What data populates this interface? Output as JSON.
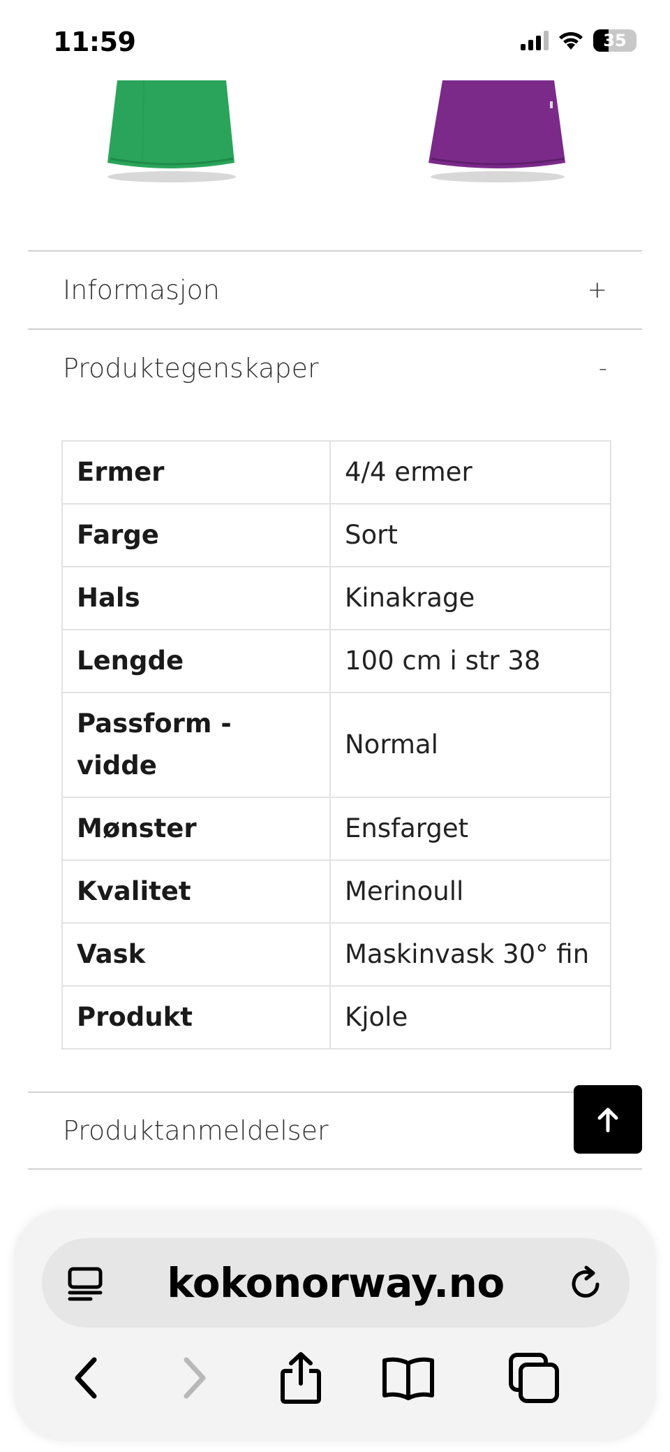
{
  "status": {
    "time": "11:59",
    "battery": "35"
  },
  "accordion": {
    "info": {
      "label": "Informasjon",
      "sign": "+"
    },
    "properties": {
      "label": "Produktegenskaper",
      "sign": "-"
    },
    "reviews": {
      "label": "Produktanmeldelser"
    }
  },
  "specs": [
    {
      "key": "Ermer",
      "value": "4/4 ermer"
    },
    {
      "key": "Farge",
      "value": "Sort"
    },
    {
      "key": "Hals",
      "value": "Kinakrage"
    },
    {
      "key": "Lengde",
      "value": "100 cm i str 38"
    },
    {
      "key": "Passform - vidde",
      "value": "Normal"
    },
    {
      "key": "Mønster",
      "value": "Ensfarget"
    },
    {
      "key": "Kvalitet",
      "value": "Merinoull"
    },
    {
      "key": "Vask",
      "value": "Maskinvask 30° fin"
    },
    {
      "key": "Produkt",
      "value": "Kjole"
    }
  ],
  "browser": {
    "url": "kokonorway.no"
  },
  "colors": {
    "green": "#2aa45a",
    "purple": "#7b2a8a"
  }
}
